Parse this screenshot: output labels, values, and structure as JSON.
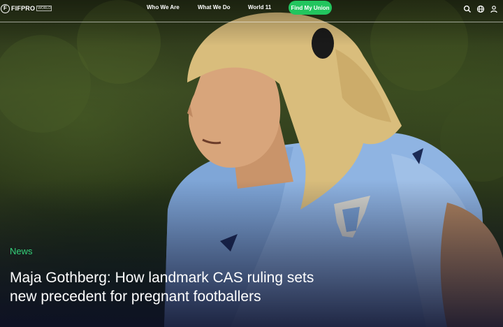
{
  "header": {
    "brand": "FIFPRO",
    "brand_tag": "WORLD PLAYERS UNION",
    "nav": [
      "Who We Are",
      "What We Do",
      "World 11"
    ],
    "cta_label": "Find My Union",
    "icons": [
      "search-icon",
      "globe-icon",
      "user-icon"
    ]
  },
  "article": {
    "category": "News",
    "headline": "Maja Gothberg: How landmark CAS ruling sets new precedent for pregnant footballers"
  },
  "colors": {
    "accent_green": "#22c55e",
    "category_green": "#34d17a",
    "jersey_blue": "#8fb4e2"
  }
}
